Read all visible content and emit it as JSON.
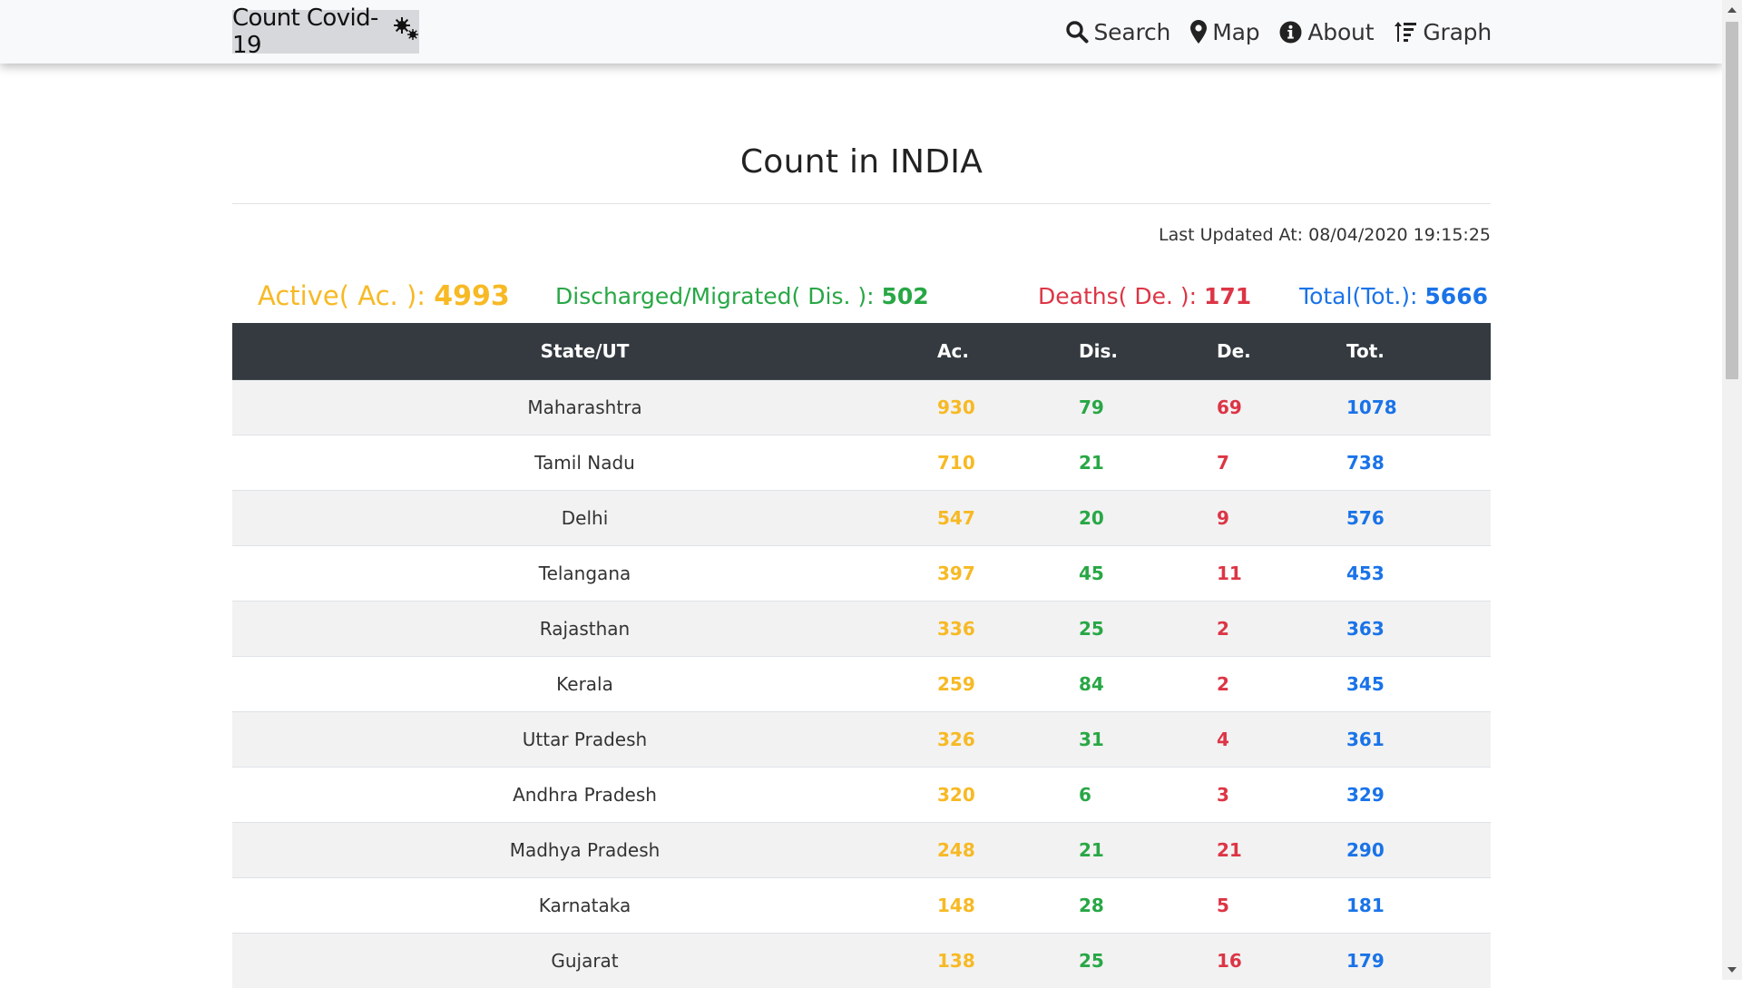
{
  "nav": {
    "brand": "Count Covid-19",
    "brand_icon": "virus-icon",
    "links": [
      {
        "label": "Search",
        "icon": "search-icon"
      },
      {
        "label": "Map",
        "icon": "map-marker-icon"
      },
      {
        "label": "About",
        "icon": "info-circle-icon"
      },
      {
        "label": "Graph",
        "icon": "sort-amount-icon"
      }
    ]
  },
  "main": {
    "title": "Count in INDIA",
    "last_updated_label": "Last Updated At:",
    "last_updated_value": "08/04/2020 19:15:25",
    "summary": {
      "active_label": "Active( Ac. ):",
      "active_value": "4993",
      "discharged_label": "Discharged/Migrated( Dis. ):",
      "discharged_value": "502",
      "deaths_label": "Deaths( De. ):",
      "deaths_value": "171",
      "total_label": "Total(Tot.):",
      "total_value": "5666"
    },
    "table": {
      "headers": [
        "State/UT",
        "Ac.",
        "Dis.",
        "De.",
        "Tot."
      ],
      "rows": [
        [
          "Maharashtra",
          "930",
          "79",
          "69",
          "1078"
        ],
        [
          "Tamil Nadu",
          "710",
          "21",
          "7",
          "738"
        ],
        [
          "Delhi",
          "547",
          "20",
          "9",
          "576"
        ],
        [
          "Telangana",
          "397",
          "45",
          "11",
          "453"
        ],
        [
          "Rajasthan",
          "336",
          "25",
          "2",
          "363"
        ],
        [
          "Kerala",
          "259",
          "84",
          "2",
          "345"
        ],
        [
          "Uttar Pradesh",
          "326",
          "31",
          "4",
          "361"
        ],
        [
          "Andhra Pradesh",
          "320",
          "6",
          "3",
          "329"
        ],
        [
          "Madhya Pradesh",
          "248",
          "21",
          "21",
          "290"
        ],
        [
          "Karnataka",
          "148",
          "28",
          "5",
          "181"
        ],
        [
          "Gujarat",
          "138",
          "25",
          "16",
          "179"
        ]
      ]
    }
  },
  "colors": {
    "active": "#f7b924",
    "discharged": "#28a745",
    "deaths": "#dc3545",
    "total": "#1a73e8",
    "table_header_bg": "#343a40"
  }
}
